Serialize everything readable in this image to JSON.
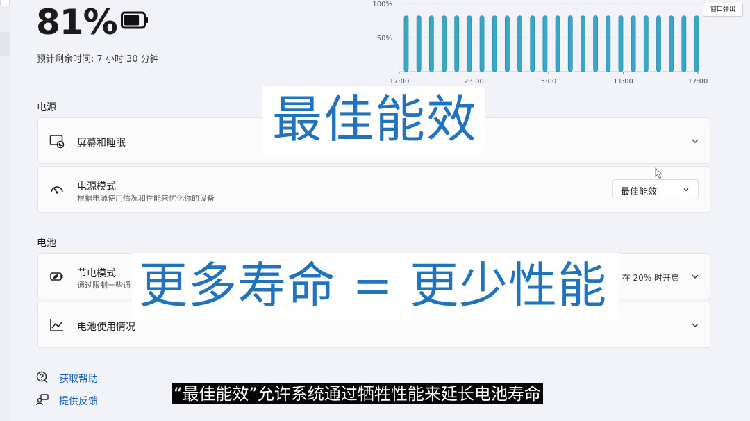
{
  "battery": {
    "percent": "81%",
    "level": 0.81,
    "remaining_label": "预计剩余时间: 7 小时 30 分钟"
  },
  "chart_data": {
    "type": "bar",
    "y_ticks": [
      "100%",
      "50%"
    ],
    "x_ticks": [
      "17:00",
      "23:00",
      "5:00",
      "11:00",
      "17:00"
    ],
    "ylim": [
      0,
      100
    ],
    "values": [
      82,
      82,
      82,
      82,
      82,
      82,
      82,
      82,
      82,
      82,
      82,
      82,
      82,
      82,
      82,
      82,
      82,
      82,
      82,
      82,
      82,
      82,
      82,
      82
    ],
    "grid": true,
    "color": "#3aa7c6"
  },
  "popout": {
    "label": "窗口弹出"
  },
  "power_section": {
    "label": "电源",
    "screen_sleep": {
      "title": "屏幕和睡眠",
      "icon": "screen-sleep-icon"
    },
    "power_mode": {
      "title": "电源模式",
      "subtitle": "根据电源使用情况和性能来优化你的设备",
      "selected": "最佳能效",
      "icon": "power-mode-gauge-icon"
    }
  },
  "battery_section": {
    "label": "电池",
    "saver": {
      "title": "节电模式",
      "subtitle": "通过限制一些通",
      "status": "在 20% 时开启",
      "icon": "battery-saver-icon"
    },
    "usage": {
      "title": "电池使用情况",
      "icon": "battery-usage-chart-icon"
    }
  },
  "links": {
    "help": "获取帮助",
    "feedback": "提供反馈"
  },
  "overlays": {
    "headline1": "最佳能效",
    "headline2": "更多寿命 = 更少性能",
    "subtitle": "“最佳能效”允许系统通过牺牲性能来延长电池寿命"
  },
  "colors": {
    "accent": "#2173bd",
    "bar": "#3aa7c6",
    "link": "#1a5fb4"
  }
}
